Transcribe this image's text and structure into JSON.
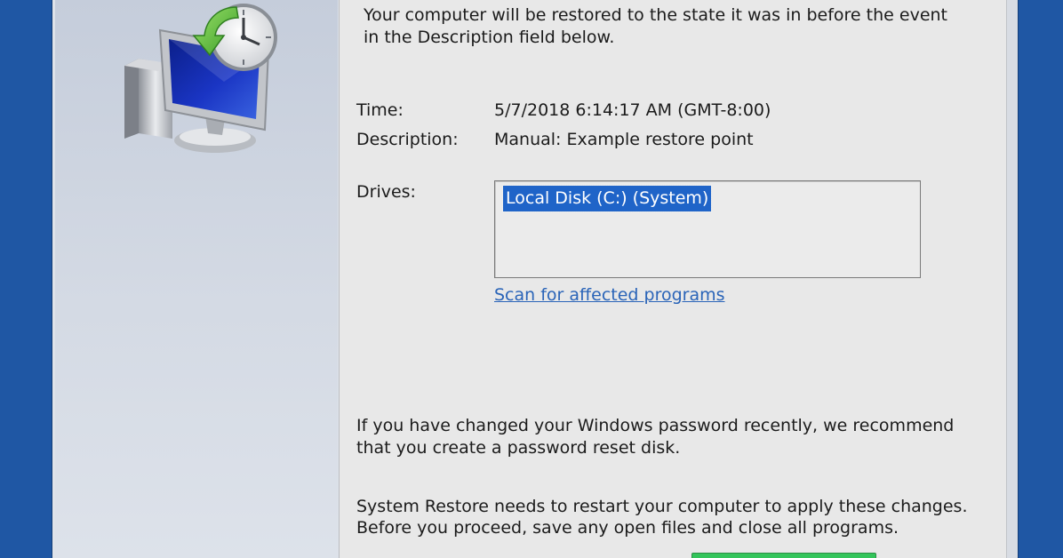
{
  "intro": {
    "line1": "Your computer will be restored to the state it was in before the event",
    "line2": "in the Description field below."
  },
  "details": {
    "time_label": "Time:",
    "time_value": "5/7/2018 6:14:17 AM (GMT-8:00)",
    "description_label": "Description:",
    "description_value": "Manual: Example restore point",
    "drives_label": "Drives:",
    "drives": [
      "Local Disk (C:) (System)"
    ]
  },
  "scan_link": "Scan for affected programs",
  "password_note": {
    "line1": "If you have changed your Windows password recently, we recommend",
    "line2": "that you create a password reset disk."
  },
  "restart_note": {
    "line1": "System Restore needs to restart your computer to apply these changes.",
    "line2": "Before you proceed, save any open files and close all programs."
  },
  "icons": {
    "restore": "system-restore-icon"
  },
  "colors": {
    "desktop": "#1f57a4",
    "selection": "#1f64c8",
    "link": "#2a64b8"
  }
}
